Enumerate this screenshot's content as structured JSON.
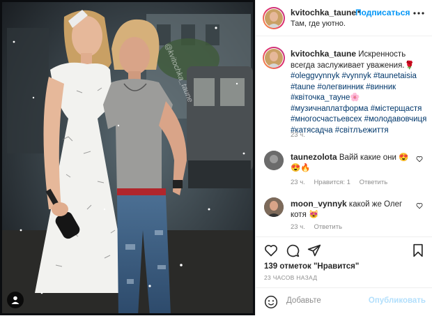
{
  "post": {
    "username": "kvitochka_taune",
    "location": "Там, где уютно.",
    "follow_label": "Подписаться",
    "watermark": "@kvitochka_taune",
    "caption_text": "Искренность всегда заслуживает уважения.",
    "caption_emoji": "🌹",
    "hashtags": [
      "#oleggvynnyk",
      "#vynnyk",
      "#taunetaisia",
      "#taune",
      "#олегвинник",
      "#винник",
      "#квіточка_тауне",
      "🌸",
      "#музичнаплатформа",
      "#містерщастя",
      "#многосчастьевсех",
      "#молодавовчиця",
      "#катясадча",
      "#світлъежиття"
    ],
    "caption_time": "23 ч."
  },
  "comments": [
    {
      "username": "taunezolota",
      "text": "Вайй какие они",
      "emoji": "😍 😍🔥",
      "time": "23 ч.",
      "likes_label": "Нравится: 1",
      "reply_label": "Ответить"
    },
    {
      "username": "moon_vynnyk",
      "text": "какой же Олег котя",
      "emoji": "😻",
      "time": "23 ч.",
      "reply_label": "Ответить"
    }
  ],
  "stats": {
    "likes": "139 отметок \"Нравится\"",
    "ago": "23 ЧАСОВ НАЗАД"
  },
  "add_comment": {
    "placeholder": "Добавьте",
    "publish_label": "Опубликовать"
  },
  "icons": [
    "more-icon",
    "heart-icon",
    "comment-icon",
    "share-icon",
    "bookmark-icon",
    "emoji-icon",
    "tagged-user-icon"
  ]
}
